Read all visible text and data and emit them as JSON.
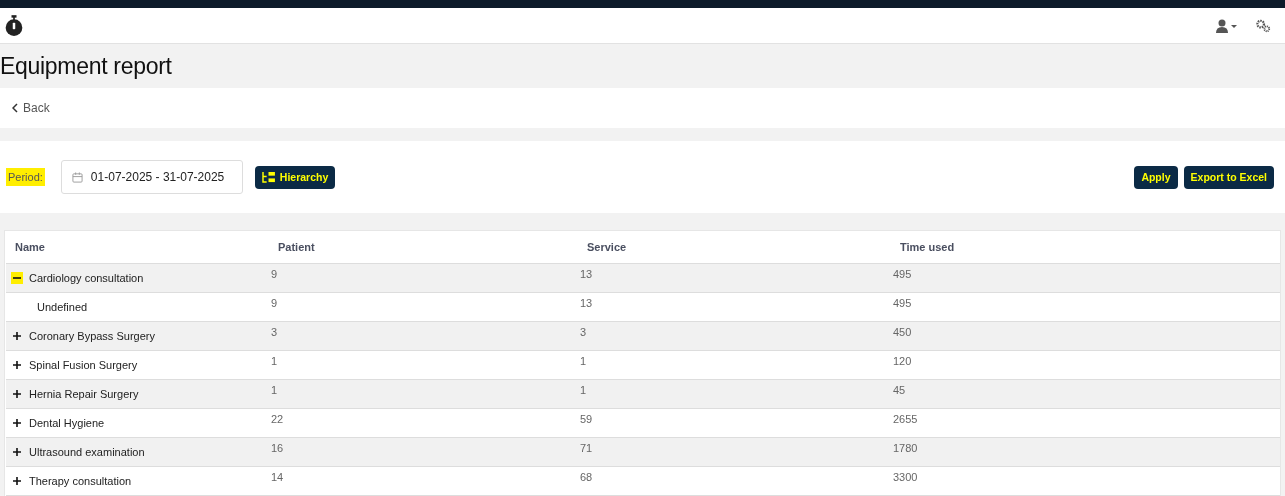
{
  "page_title": "Equipment report",
  "back_link": "Back",
  "filter": {
    "label": "Period:",
    "date_range": "01-07-2025 - 31-07-2025",
    "hierarchy_button": "Hierarchy",
    "apply_button": "Apply",
    "export_button": "Export to Excel"
  },
  "table": {
    "columns": [
      "Name",
      "Patient",
      "Service",
      "Time used"
    ],
    "rows": [
      {
        "name": "Cardiology consultation",
        "patient": "9",
        "service": "13",
        "time_used": "495",
        "expanded": true,
        "children": [
          {
            "name": "Undefined",
            "patient": "9",
            "service": "13",
            "time_used": "495"
          }
        ]
      },
      {
        "name": "Coronary Bypass Surgery",
        "patient": "3",
        "service": "3",
        "time_used": "450",
        "expanded": false
      },
      {
        "name": "Spinal Fusion Surgery",
        "patient": "1",
        "service": "1",
        "time_used": "120",
        "expanded": false
      },
      {
        "name": "Hernia Repair Surgery",
        "patient": "1",
        "service": "1",
        "time_used": "45",
        "expanded": false
      },
      {
        "name": "Dental Hygiene",
        "patient": "22",
        "service": "59",
        "time_used": "2655",
        "expanded": false
      },
      {
        "name": "Ultrasound examination",
        "patient": "16",
        "service": "71",
        "time_used": "1780",
        "expanded": false
      },
      {
        "name": "Therapy consultation",
        "patient": "14",
        "service": "68",
        "time_used": "3300",
        "expanded": false
      }
    ]
  }
}
